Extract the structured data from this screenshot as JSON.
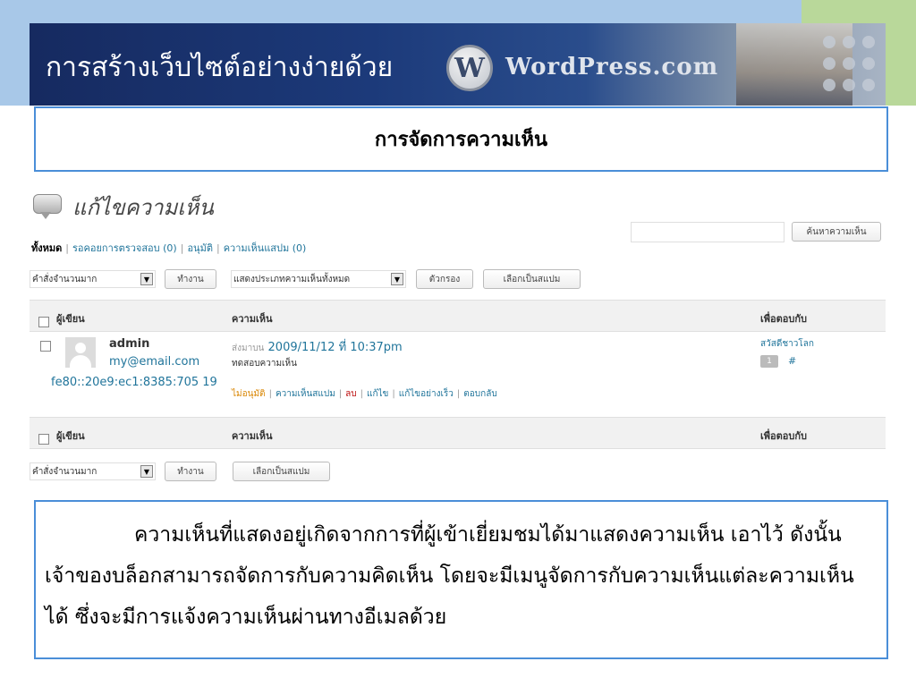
{
  "slide": {
    "banner_title": "การสร้างเว็บไซต์อย่างง่ายด้วย",
    "wp_logo_letter": "W",
    "wp_wordmark": "WordPress.com",
    "box_title": "การจัดการความเห็น",
    "caption": "ความเห็นที่แสดงอยู่เกิดจากการที่ผู้เข้าเยี่ยมชมได้มาแสดงความเห็น เอาไว้ ดังนั้นเจ้าของบล็อกสามารถจัดการกับความคิดเห็น โดยจะมีเมนูจัดการกับความเห็นแต่ละความเห็นได้ ซึ่งจะมีการแจ้งความเห็นผ่านทางอีเมลด้วย"
  },
  "admin": {
    "page_title": "แก้ไขความเห็น",
    "filters": {
      "all": "ทั้งหมด",
      "pending": "รอคอยการตรวจสอบ (0)",
      "approved": "อนุมัติ",
      "spam": "ความเห็นแสปม (0)"
    },
    "search_button": "ค้นหาความเห็น",
    "bulk_actions_top": "คำสั่งจำนวนมาก",
    "apply_top": "ทำงาน",
    "comment_type": "แสดงประเภทความเห็นทั้งหมด",
    "filter_button": "ตัวกรอง",
    "mark_spam_top": "เลือกเป็นสแปม",
    "columns": {
      "author": "ผู้เขียน",
      "comment": "ความเห็น",
      "in_response_to": "เพื่อตอบกับ"
    },
    "comment": {
      "author_name": "admin",
      "author_email": "my@email.com",
      "author_ip": "fe80::20e9:ec1:8385:705 19",
      "submitted_prefix": "ส่งมาบน",
      "submitted_date": "2009/11/12 ที่ 10:37pm",
      "text": "ทดสอบความเห็น",
      "actions": {
        "unapprove": "ไม่อนุมัติ",
        "spam": "ความเห็นสแปม",
        "delete": "ลบ",
        "edit": "แก้ไข",
        "quick_edit": "แก้ไขอย่างเร็ว",
        "reply": "ตอบกลับ"
      },
      "post_title": "สวัสดีชาวโลก",
      "post_comment_count": "1",
      "post_hash": "#"
    },
    "bulk_actions_bottom": "คำสั่งจำนวนมาก",
    "apply_bottom": "ทำงาน",
    "mark_spam_bottom": "เลือกเป็นสแปม"
  },
  "colors": {
    "accent_blue": "#4a8ed8",
    "link": "#21759b",
    "unapprove": "#d98500",
    "delete": "#bc0b0b"
  },
  "icons": [
    "comments-icon",
    "select-arrow-icon",
    "avatar-icon",
    "wordpress-logo-icon"
  ]
}
